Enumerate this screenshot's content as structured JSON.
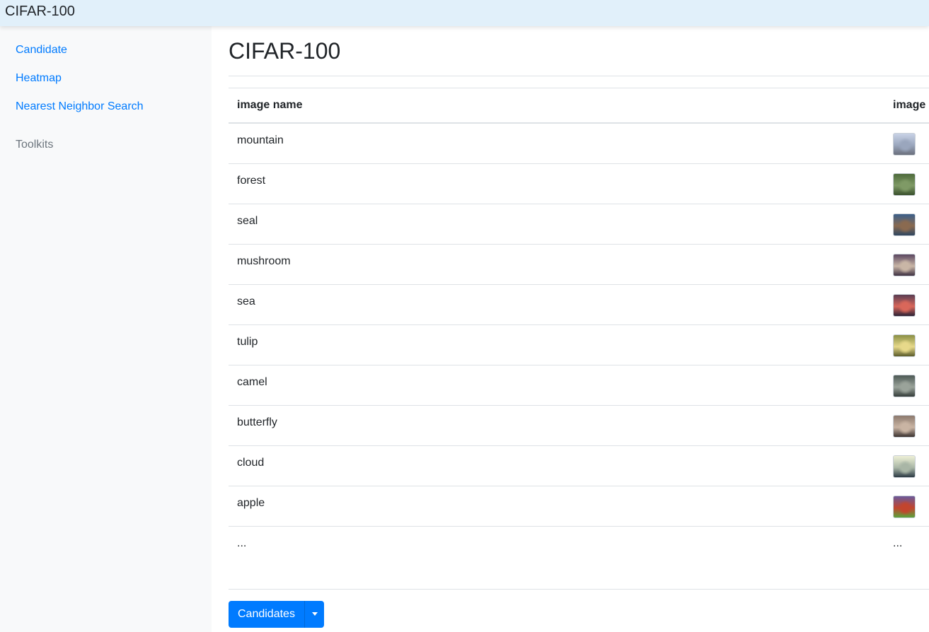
{
  "app": {
    "title": "CIFAR-100"
  },
  "sidebar": {
    "links": [
      {
        "label": "Candidate"
      },
      {
        "label": "Heatmap"
      },
      {
        "label": "Nearest Neighbor Search"
      }
    ],
    "section_heading": "Toolkits"
  },
  "main": {
    "title": "CIFAR-100",
    "table": {
      "columns": [
        "image name",
        "image"
      ],
      "rows": [
        {
          "name": "mountain",
          "thumb_colors": [
            "#c8d2e6",
            "#9aa6bd",
            "#6a6f7c"
          ]
        },
        {
          "name": "forest",
          "thumb_colors": [
            "#4f6b3c",
            "#7f9a66",
            "#39502c"
          ]
        },
        {
          "name": "seal",
          "thumb_colors": [
            "#3b5f8a",
            "#8a6a50",
            "#2f4660"
          ]
        },
        {
          "name": "mushroom",
          "thumb_colors": [
            "#5b4760",
            "#c9b6a6",
            "#3f3142"
          ]
        },
        {
          "name": "sea",
          "thumb_colors": [
            "#5a3d52",
            "#d9675a",
            "#2c2235"
          ]
        },
        {
          "name": "tulip",
          "thumb_colors": [
            "#8a8f45",
            "#e7d98a",
            "#5b5c2a"
          ]
        },
        {
          "name": "camel",
          "thumb_colors": [
            "#4e5a56",
            "#9aa39a",
            "#353d3a"
          ]
        },
        {
          "name": "butterfly",
          "thumb_colors": [
            "#8d7a6e",
            "#c9b4a3",
            "#3b3230"
          ]
        },
        {
          "name": "cloud",
          "thumb_colors": [
            "#eef0d6",
            "#a9b6a6",
            "#2c3a44"
          ]
        },
        {
          "name": "apple",
          "thumb_colors": [
            "#6a5a9a",
            "#c2452e",
            "#5aa33b"
          ]
        },
        {
          "name": "...",
          "thumb_text": "..."
        }
      ]
    }
  },
  "footer": {
    "button_label": "Candidates"
  },
  "colors": {
    "accent": "#007bff",
    "topbar": "#e1f0fa",
    "sidebar": "#f8f9fa"
  }
}
